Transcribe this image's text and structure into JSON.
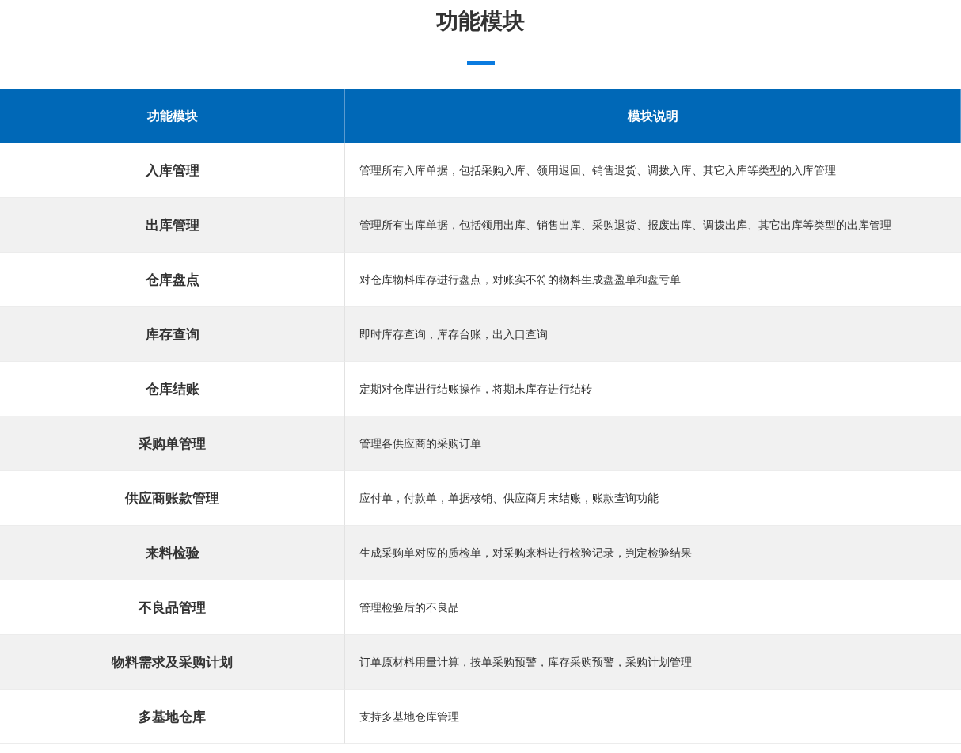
{
  "title": "功能模块",
  "table": {
    "columns": [
      "功能模块",
      "模块说明"
    ],
    "rows": [
      {
        "module": "入库管理",
        "description": "管理所有入库单据，包括采购入库、领用退回、销售退货、调拨入库、其它入库等类型的入库管理"
      },
      {
        "module": "出库管理",
        "description": "管理所有出库单据，包括领用出库、销售出库、采购退货、报废出库、调拨出库、其它出库等类型的出库管理"
      },
      {
        "module": "仓库盘点",
        "description": "对仓库物料库存进行盘点，对账实不符的物料生成盘盈单和盘亏单"
      },
      {
        "module": "库存查询",
        "description": "即时库存查询，库存台账，出入口查询"
      },
      {
        "module": "仓库结账",
        "description": "定期对仓库进行结账操作，将期末库存进行结转"
      },
      {
        "module": "采购单管理",
        "description": "管理各供应商的采购订单"
      },
      {
        "module": "供应商账款管理",
        "description": "应付单，付款单，单据核销、供应商月末结账，账款查询功能"
      },
      {
        "module": "来料检验",
        "description": "生成采购单对应的质检单，对采购来料进行检验记录，判定检验结果"
      },
      {
        "module": "不良品管理",
        "description": "管理检验后的不良品"
      },
      {
        "module": "物料需求及采购计划",
        "description": "订单原材料用量计算，按单采购预警，库存采购预警，采购计划管理"
      },
      {
        "module": "多基地仓库",
        "description": "支持多基地仓库管理"
      }
    ]
  }
}
